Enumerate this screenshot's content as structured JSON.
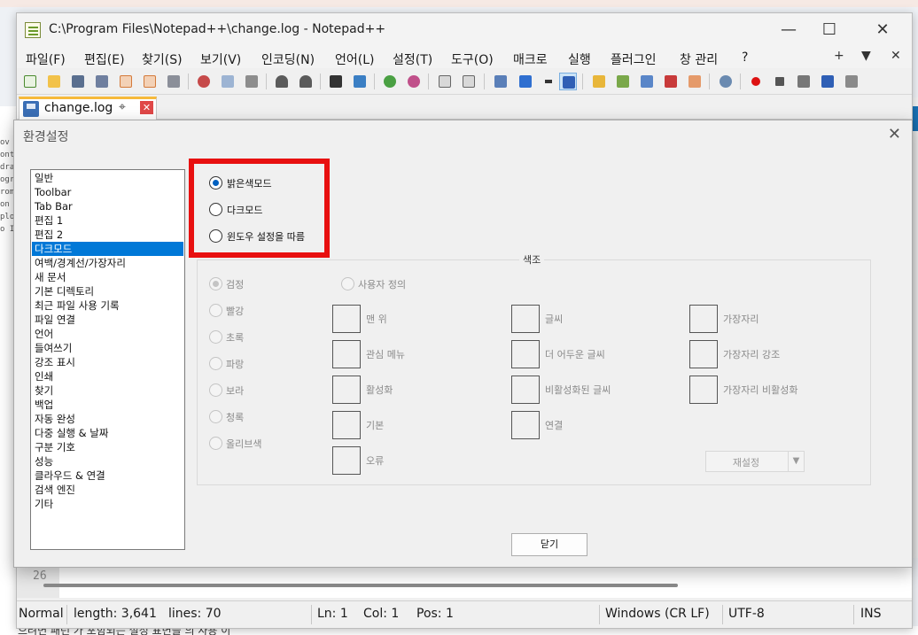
{
  "window": {
    "title": "C:\\Program Files\\Notepad++\\change.log - Notepad++",
    "minimize": "—",
    "maximize": "☐",
    "close": "✕"
  },
  "menu": {
    "items": [
      "파일(F)",
      "편집(E)",
      "찾기(S)",
      "보기(V)",
      "인코딩(N)",
      "언어(L)",
      "설정(T)",
      "도구(O)",
      "매크로",
      "실행",
      "플러그인",
      "창 관리",
      "?"
    ],
    "right": [
      "+",
      "▼",
      "✕"
    ]
  },
  "tab": {
    "label": "change.log",
    "pin": "⌖",
    "close": "✕"
  },
  "editor": {
    "line_number": "26"
  },
  "status": {
    "lang": "Normal",
    "length": "length: 3,641",
    "lines": "lines: 70",
    "ln": "Ln: 1",
    "col": "Col: 1",
    "pos": "Pos: 1",
    "eol": "Windows (CR LF)",
    "encoding": "UTF-8",
    "mode": "INS"
  },
  "dialog": {
    "title": "환경설정",
    "close": "✕",
    "categories": [
      "일반",
      "Toolbar",
      "Tab Bar",
      "편집 1",
      "편집 2",
      "다크모드",
      "여백/경계선/가장자리",
      "새 문서",
      "기본 디렉토리",
      "최근 파일 사용 기록",
      "파일 연결",
      "언어",
      "들여쓰기",
      "강조 표시",
      "인쇄",
      "찾기",
      "백업",
      "자동 완성",
      "다중 실행 & 날짜",
      "구분 기호",
      "성능",
      "클라우드 & 연결",
      "검색 엔진",
      "기타"
    ],
    "selected_category": "다크모드",
    "modes": [
      "밝은색모드",
      "다크모드",
      "윈도우 설정을 따름"
    ],
    "selected_mode": "밝은색모드",
    "tone_group_label": "색조",
    "tones": [
      "검정",
      "빨강",
      "초록",
      "파랑",
      "보라",
      "청록",
      "올리브색"
    ],
    "selected_tone": "검정",
    "custom_label": "사용자 정의",
    "color_items": [
      [
        "맨 위",
        "관심 메뉴",
        "활성화",
        "기본",
        "오류"
      ],
      [
        "글씨",
        "더 어두운 글씨",
        "비활성화된 글씨",
        "연결"
      ],
      [
        "가장자리",
        "가장자리 강조",
        "가장자리 비활성화"
      ]
    ],
    "reset_label": "재설정",
    "reset_dropdown": "▼",
    "close_button": "닫기"
  },
  "background": {
    "code_fragments": [
      "ov",
      "ont",
      "dra",
      "ogr",
      "rom",
      "on",
      "plo",
      "o I"
    ],
    "bottom_text": "으려면 패턴 가 포함되는 설정 표면을 의 사용 이"
  }
}
